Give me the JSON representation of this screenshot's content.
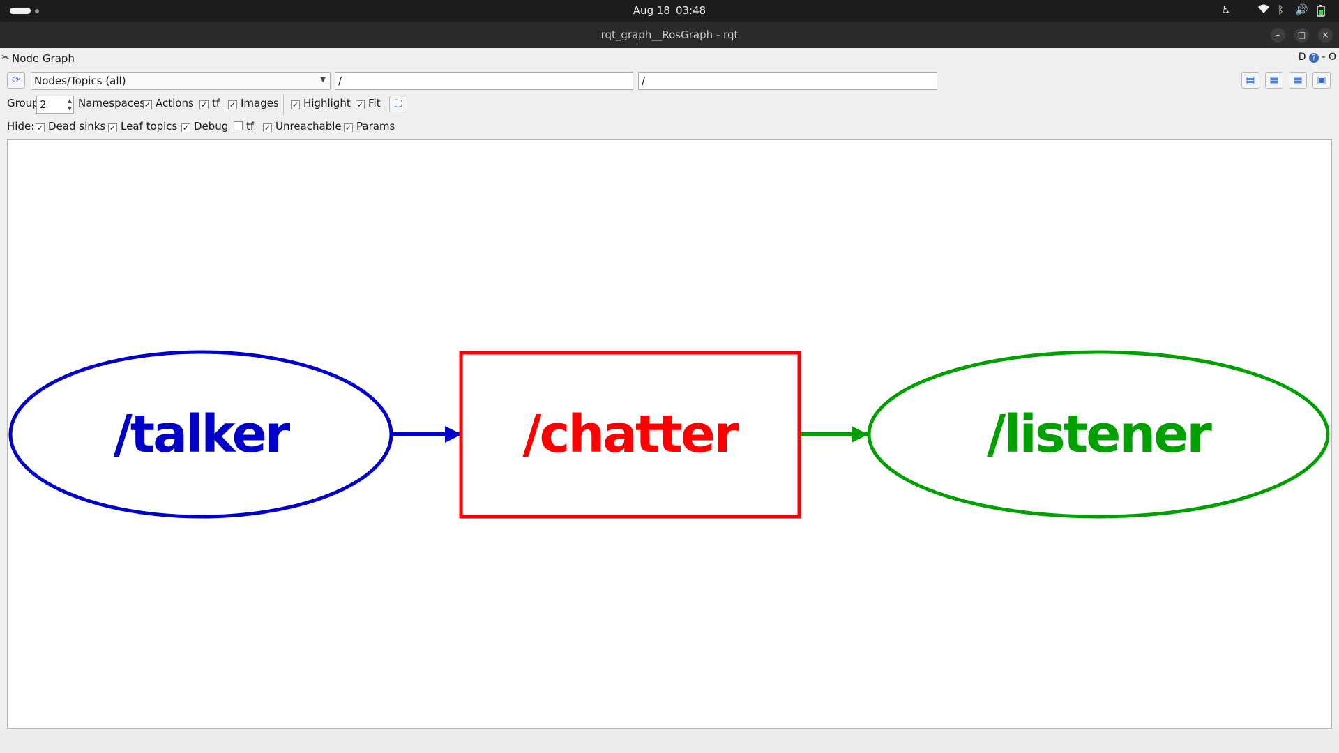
{
  "topbar": {
    "date": "Aug 18",
    "time": "03:48",
    "tray_icons": [
      "accessibility-icon",
      "wifi-icon",
      "bluetooth-icon",
      "volume-icon",
      "battery-icon"
    ]
  },
  "window": {
    "title": "rqt_graph__RosGraph - rqt",
    "buttons": {
      "minimize": "–",
      "maximize": "□",
      "close": "×"
    }
  },
  "plugin": {
    "title": "Node Graph",
    "right_label": "D",
    "right_extra": "- O"
  },
  "toolbar": {
    "graph_type": "Nodes/Topics (all)",
    "node_filter": "/",
    "topic_filter": "/"
  },
  "options": {
    "group_label": "Group:",
    "group_value": "2",
    "namespaces_label": "Namespaces",
    "actions_label": "Actions",
    "actions_checked": true,
    "tf_label": "tf",
    "tf_checked": true,
    "images_label": "Images",
    "images_checked": true,
    "highlight_label": "Highlight",
    "highlight_checked": true,
    "fit_label": "Fit",
    "fit_checked": true
  },
  "hide": {
    "label": "Hide:",
    "dead_sinks": "Dead sinks",
    "leaf_topics": "Leaf topics",
    "debug": "Debug",
    "tf": "tf",
    "unreachable": "Unreachable",
    "params": "Params",
    "tf_checked": false
  },
  "graph": {
    "nodes": [
      {
        "label": "/talker",
        "kind": "node",
        "color": "#0000c8"
      },
      {
        "label": "/chatter",
        "kind": "topic",
        "color": "#ff0000"
      },
      {
        "label": "/listener",
        "kind": "node",
        "color": "#00a000"
      }
    ],
    "edges": [
      {
        "from": "/talker",
        "to": "/chatter",
        "color": "#0000c8"
      },
      {
        "from": "/chatter",
        "to": "/listener",
        "color": "#00a000"
      }
    ]
  }
}
